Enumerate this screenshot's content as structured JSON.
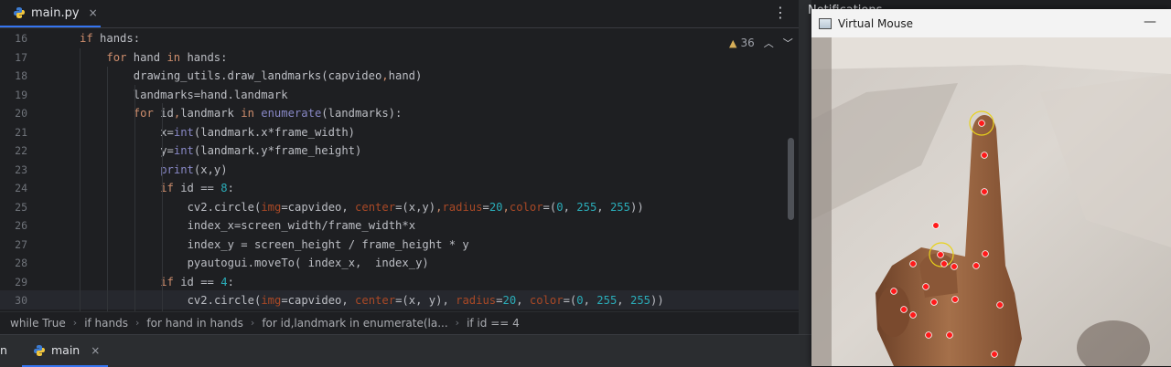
{
  "editor": {
    "tab": {
      "label": "main.py",
      "close": "×"
    },
    "menu_glyph": "⋮",
    "inspection": {
      "icon": "warning-icon",
      "count": "36"
    },
    "lines": [
      {
        "num": "16",
        "indent": 1,
        "tokens": [
          [
            "kw",
            "if "
          ],
          [
            "",
            "hands:"
          ]
        ]
      },
      {
        "num": "17",
        "indent": 2,
        "tokens": [
          [
            "kw",
            "for "
          ],
          [
            "",
            "hand "
          ],
          [
            "kw",
            "in "
          ],
          [
            "",
            "hands:"
          ]
        ]
      },
      {
        "num": "18",
        "indent": 3,
        "tokens": [
          [
            "",
            "drawing_utils.draw_landmarks(capvideo"
          ],
          [
            "kw",
            ","
          ],
          [
            "",
            "hand)"
          ]
        ]
      },
      {
        "num": "19",
        "indent": 3,
        "tokens": [
          [
            "",
            "landmarks=hand.landmark"
          ]
        ]
      },
      {
        "num": "20",
        "indent": 3,
        "tokens": [
          [
            "kw",
            "for "
          ],
          [
            "",
            "id"
          ],
          [
            "kw",
            ","
          ],
          [
            "",
            "landmark "
          ],
          [
            "kw",
            "in "
          ],
          [
            "bi",
            "enumerate"
          ],
          [
            "",
            "(landmarks):"
          ]
        ]
      },
      {
        "num": "21",
        "indent": 4,
        "tokens": [
          [
            "",
            "x="
          ],
          [
            "bi",
            "int"
          ],
          [
            "",
            "(landmark.x*frame_width)"
          ]
        ]
      },
      {
        "num": "22",
        "indent": 4,
        "tokens": [
          [
            "",
            "y="
          ],
          [
            "bi",
            "int"
          ],
          [
            "",
            "(landmark.y*frame_height)"
          ]
        ]
      },
      {
        "num": "23",
        "indent": 4,
        "tokens": [
          [
            "bi",
            "print"
          ],
          [
            "",
            "(x,y)"
          ]
        ]
      },
      {
        "num": "24",
        "indent": 4,
        "tokens": [
          [
            "kw",
            "if "
          ],
          [
            "",
            "id == "
          ],
          [
            "num",
            "8"
          ],
          [
            "",
            ":"
          ]
        ]
      },
      {
        "num": "25",
        "indent": 5,
        "tokens": [
          [
            "",
            "cv2.circle("
          ],
          [
            "prm",
            "img"
          ],
          [
            "",
            "=capvideo, "
          ],
          [
            "prm",
            "center"
          ],
          [
            "",
            "=(x,y)"
          ],
          [
            "kw",
            ","
          ],
          [
            "prm",
            "radius"
          ],
          [
            "",
            "="
          ],
          [
            "num",
            "20"
          ],
          [
            "kw",
            ","
          ],
          [
            "prm",
            "color"
          ],
          [
            "",
            "=("
          ],
          [
            "num",
            "0"
          ],
          [
            "",
            ", "
          ],
          [
            "num",
            "255"
          ],
          [
            "",
            ", "
          ],
          [
            "num",
            "255"
          ],
          [
            "",
            "))"
          ]
        ]
      },
      {
        "num": "26",
        "indent": 5,
        "tokens": [
          [
            "",
            "index_x=screen_width/frame_width*x"
          ]
        ]
      },
      {
        "num": "27",
        "indent": 5,
        "tokens": [
          [
            "",
            "index_y = screen_height / frame_height * y"
          ]
        ]
      },
      {
        "num": "28",
        "indent": 5,
        "tokens": [
          [
            "",
            "pyautogui.moveTo( index_x,  index_y)"
          ]
        ]
      },
      {
        "num": "29",
        "indent": 4,
        "tokens": [
          [
            "kw",
            "if "
          ],
          [
            "",
            "id == "
          ],
          [
            "num",
            "4"
          ],
          [
            "",
            ":"
          ]
        ]
      },
      {
        "num": "30",
        "indent": 5,
        "tokens": [
          [
            "",
            "cv2.circle("
          ],
          [
            "prm",
            "img"
          ],
          [
            "",
            "=capvideo, "
          ],
          [
            "prm",
            "center"
          ],
          [
            "",
            "=(x, y), "
          ],
          [
            "prm",
            "radius"
          ],
          [
            "",
            "="
          ],
          [
            "num",
            "20"
          ],
          [
            "",
            ", "
          ],
          [
            "prm",
            "color"
          ],
          [
            "",
            "=("
          ],
          [
            "num",
            "0"
          ],
          [
            "",
            ", "
          ],
          [
            "num",
            "255"
          ],
          [
            "",
            ", "
          ],
          [
            "num",
            "255"
          ],
          [
            "",
            "))"
          ]
        ]
      }
    ],
    "breadcrumb": [
      "while True",
      "if hands",
      "for hand in hands",
      "for id,landmark in enumerate(la...",
      "if id == 4"
    ]
  },
  "bottom": {
    "partial_label": "n",
    "run_tab": {
      "label": "main",
      "close": "×"
    }
  },
  "notifications": {
    "title": "Notifications"
  },
  "virtual_mouse": {
    "title": "Virtual Mouse",
    "minimize": "—",
    "colors": {
      "landmark": "#ff1a1a",
      "ring": "#e8d21a"
    }
  }
}
